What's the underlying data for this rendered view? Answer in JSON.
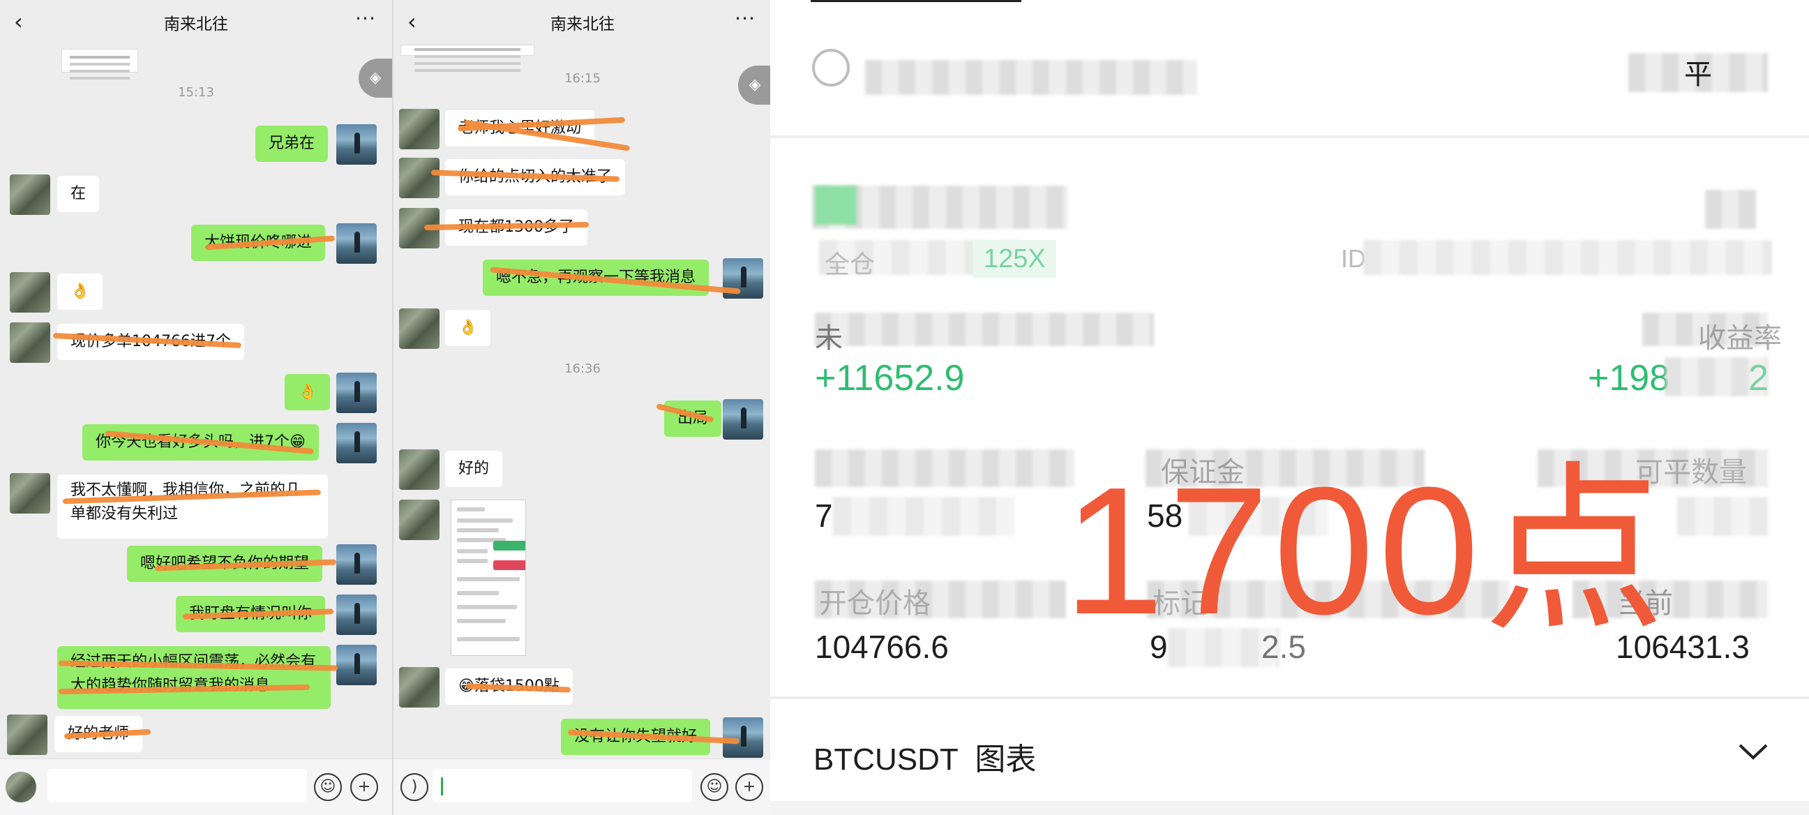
{
  "chat1": {
    "title": "南来北往",
    "timestamp": "15:13",
    "messages": [
      {
        "side": "right",
        "text": "兄弟在"
      },
      {
        "side": "left",
        "text": "在"
      },
      {
        "side": "right",
        "text": "大饼现价咚哪进"
      },
      {
        "side": "left",
        "text": "👌"
      },
      {
        "side": "left",
        "text": "现价多单104766进7个"
      },
      {
        "side": "right",
        "text": "👌"
      },
      {
        "side": "right",
        "text": "你今天也看好多头吗，进7个😁"
      },
      {
        "side": "left",
        "text": "我不太懂啊，我相信你，之前的几单都没有失利过"
      },
      {
        "side": "right",
        "text": "嗯好吧希望不负你的期望"
      },
      {
        "side": "right",
        "text": "我盯盘有情况叫你"
      },
      {
        "side": "right",
        "text": "经过两天的小幅区间震荡，必然会有大的趋势你随时留意我的消息"
      },
      {
        "side": "left",
        "text": "好的老师"
      }
    ]
  },
  "chat2": {
    "title": "南来北往",
    "timestamp1": "16:15",
    "timestamp2": "16:36",
    "messages": [
      {
        "side": "left",
        "text": "老师我心里好激动"
      },
      {
        "side": "left",
        "text": "你给的点切入的太准了"
      },
      {
        "side": "left",
        "text": "现在都1300多了"
      },
      {
        "side": "right",
        "text": "嗯不急，再观察一下等我消息"
      },
      {
        "side": "left",
        "text": "👌"
      },
      {
        "side": "right",
        "text": "出局"
      },
      {
        "side": "left",
        "text": "好的"
      },
      {
        "side": "left",
        "text": "😁落袋1500點"
      },
      {
        "side": "right",
        "text": "没有让你失望就好"
      }
    ]
  },
  "trade": {
    "pnl_value": "+11652.9",
    "pnl_ratio_partial": "+198",
    "pnl_ratio_tail": "2",
    "leverage": "125X",
    "amount_partial": "7",
    "margin_partial": "58",
    "open_price": "104766.6",
    "mark_price_partial_a": "9",
    "mark_price_partial_b": "2.5",
    "current_price": "106431.3",
    "chart_label": "BTCUSDT  图表",
    "overlay": "1700点",
    "label_pnl_fragment": "未",
    "label_ratio_fragment": "收益率",
    "label_leverage_fragment": "全仓",
    "label_id_fragment": "ID",
    "label_margin_fragment": "保证金",
    "label_amount_fragment": "可平数量",
    "label_open_fragment": "开仓价格",
    "label_mark_fragment": "标记",
    "label_current_fragment": "当前",
    "label_ping": "平"
  },
  "colors": {
    "bubble_green": "#95ec69",
    "profit_green": "#2ebd71",
    "overlay_red": "#f05a38",
    "strike_orange": "#f28b3b"
  }
}
